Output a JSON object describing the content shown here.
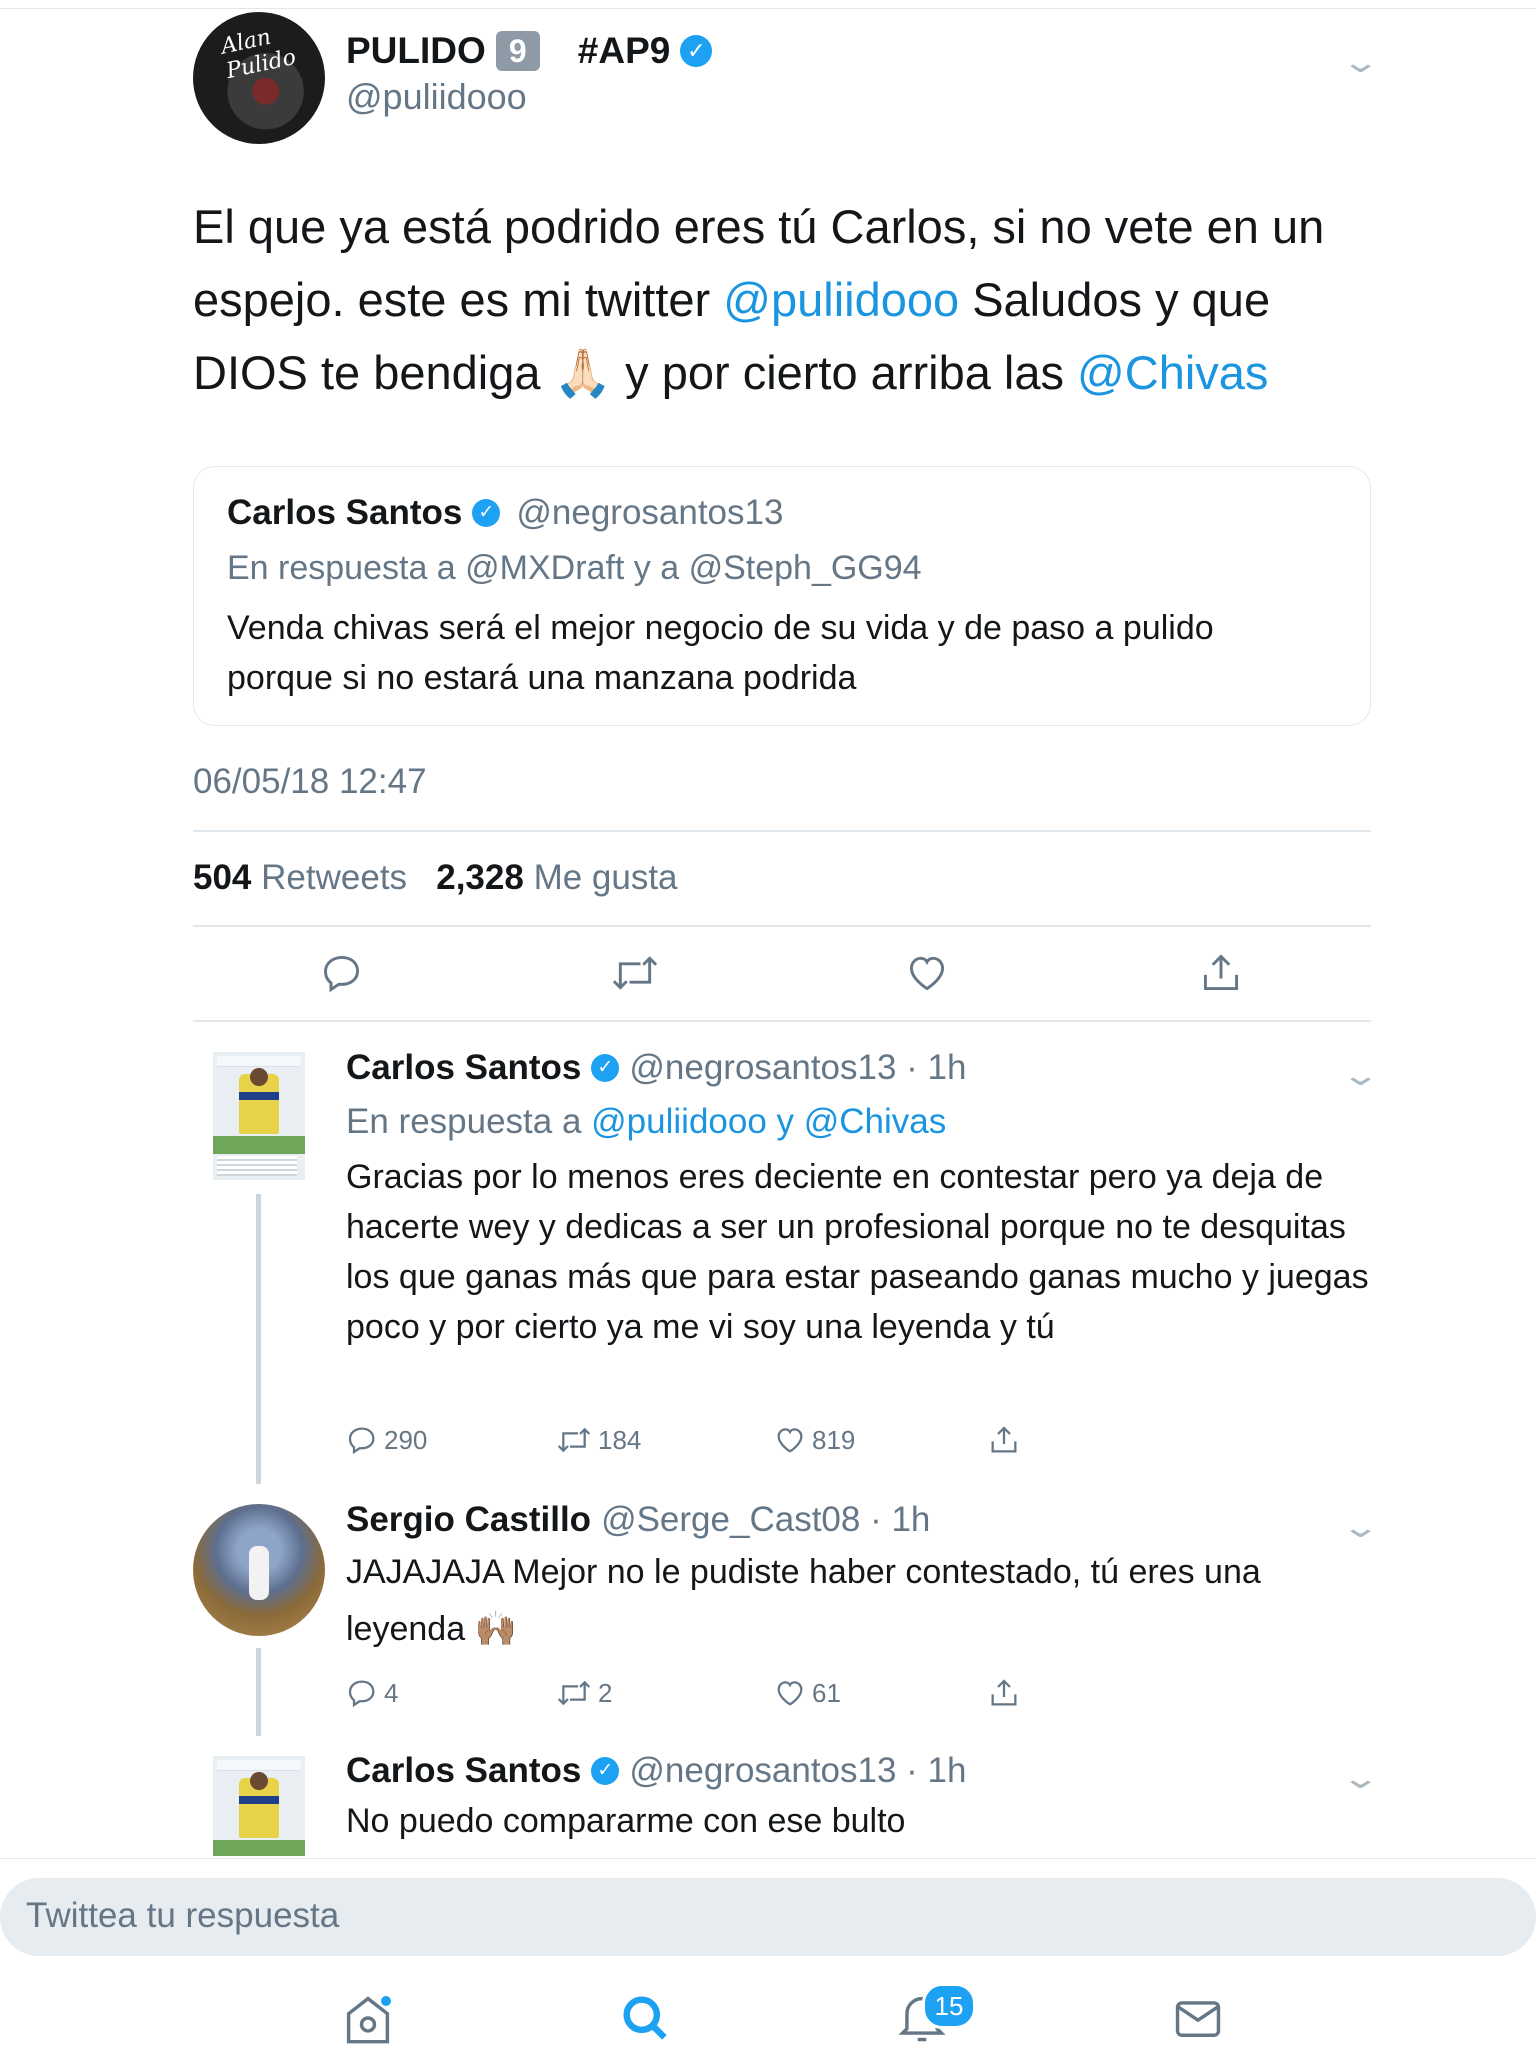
{
  "main_tweet": {
    "name": "PULIDO",
    "number_badge": "9",
    "hashtag": "#AP9",
    "handle": "@puliidooo",
    "avatar_text": "Alan Pulido",
    "text_parts": {
      "p1": "El que ya está podrido eres tú Carlos,  si no vete en un espejo. este es mi twitter ",
      "mention1": "@puliidooo",
      "p2": " Saludos y que DIOS te bendiga ",
      "emoji": "🙏🏻",
      "p3": " y por cierto arriba las ",
      "mention2": "@Chivas"
    },
    "timestamp": "06/05/18 12:47",
    "retweets_count": "504",
    "retweets_label": "Retweets",
    "likes_count": "2,328",
    "likes_label": "Me gusta"
  },
  "quoted_tweet": {
    "name": "Carlos Santos",
    "handle": "@negrosantos13",
    "reply_to": "En respuesta a @MXDraft y a @Steph_GG94",
    "text": "Venda chivas será el mejor negocio de su vida y de paso a pulido porque si no estará una manzana podrida"
  },
  "replies": [
    {
      "name": "Carlos Santos",
      "handle": "@negrosantos13 · 1h",
      "reply_prefix": "En respuesta a ",
      "reply_mentions": "@puliidooo y @Chivas",
      "text": "Gracias por lo menos eres deciente en contestar pero ya deja de hacerte wey y dedicas a ser un profesional porque no te desquitas los que ganas más que para estar paseando ganas mucho y juegas poco y por cierto ya me vi soy una leyenda y tú",
      "replies": "290",
      "retweets": "184",
      "likes": "819"
    },
    {
      "name": "Sergio Castillo",
      "handle": "@Serge_Cast08 · 1h",
      "text": "JAJAJAJA Mejor no le pudiste haber contestado, tú eres una leyenda ",
      "emoji": "🙌🏽",
      "replies": "4",
      "retweets": "2",
      "likes": "61"
    },
    {
      "name": "Carlos Santos",
      "handle": "@negrosantos13 · 1h",
      "text": "No puedo compararme con ese bulto"
    }
  ],
  "compose": {
    "placeholder": "Twittea tu respuesta"
  },
  "tabbar": {
    "notifications_count": "15"
  },
  "icons": {
    "reply": "reply-icon",
    "retweet": "retweet-icon",
    "like": "heart-icon",
    "share": "share-icon",
    "verified": "verified-badge-icon",
    "chevron": "chevron-down-icon"
  },
  "colors": {
    "link": "#1b95e0",
    "verified": "#1da1f2",
    "secondary_text": "#657786"
  }
}
